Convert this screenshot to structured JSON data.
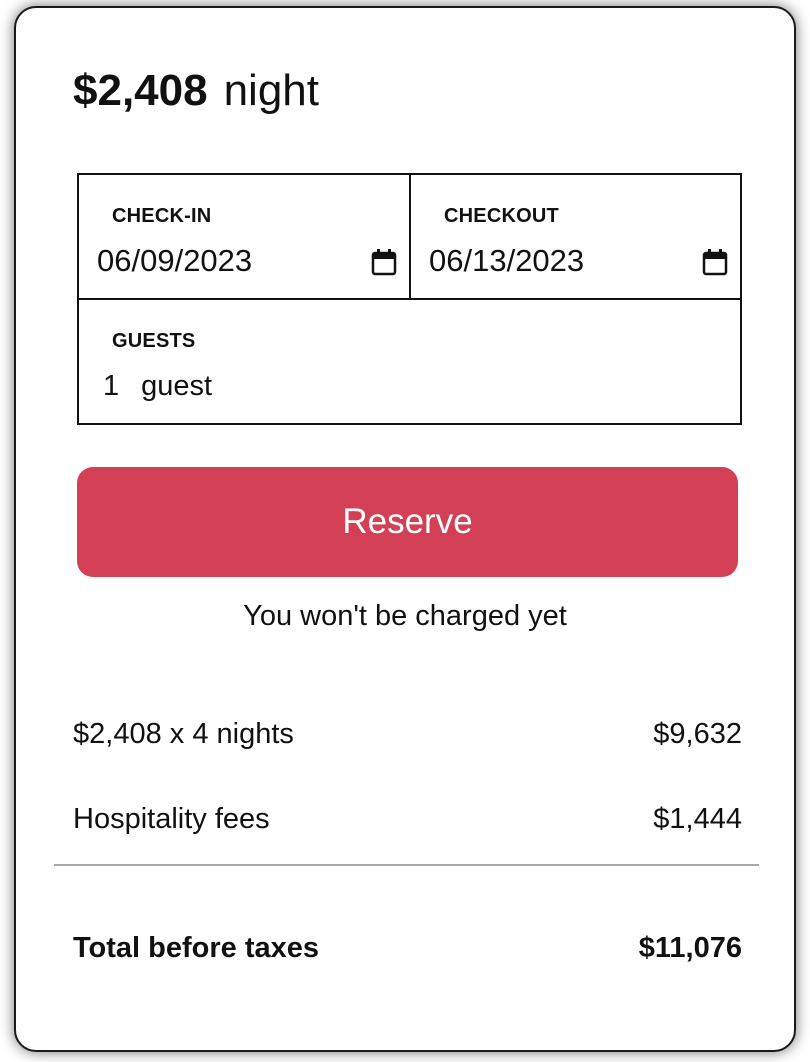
{
  "price": {
    "amount": "$2,408",
    "unit": "night"
  },
  "booking": {
    "checkin": {
      "label": "CHECK-IN",
      "value": "06/09/2023",
      "icon": "calendar-icon"
    },
    "checkout": {
      "label": "CHECKOUT",
      "value": "06/13/2023",
      "icon": "calendar-icon"
    },
    "guests": {
      "label": "GUESTS",
      "count": "1",
      "unit": "guest"
    }
  },
  "reserve": {
    "label": "Reserve",
    "color": "#d34055"
  },
  "charge_note": "You won't be charged yet",
  "breakdown": {
    "nightly": {
      "label": "$2,408 x 4 nights",
      "amount": "$9,632"
    },
    "fees": {
      "label": "Hospitality fees",
      "amount": "$1,444"
    }
  },
  "total": {
    "label": "Total before taxes",
    "amount": "$11,076"
  }
}
